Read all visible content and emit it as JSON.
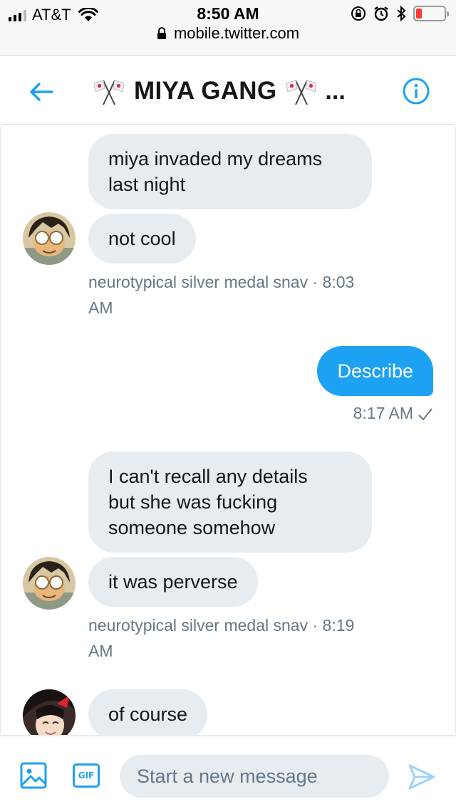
{
  "status_bar": {
    "carrier": "AT&T",
    "time": "8:50 AM",
    "url": "mobile.twitter.com"
  },
  "header": {
    "title": "MIYA GANG",
    "ellipsis": "...",
    "flag_icon": "crossed-flags-icon"
  },
  "messages": [
    {
      "type": "received",
      "text": "miya invaded my dreams\nlast night"
    },
    {
      "type": "received",
      "text": "not cool"
    },
    {
      "type": "meta",
      "text": "neurotypical silver medal snav · 8:03\nAM"
    },
    {
      "type": "sent",
      "text": "Describe"
    },
    {
      "type": "meta_sent",
      "text": "8:17 AM"
    },
    {
      "type": "received",
      "text": "I can't recall any details\nbut she was fucking\nsomeone somehow"
    },
    {
      "type": "received",
      "text": "it was perverse"
    },
    {
      "type": "meta",
      "text": "neurotypical silver medal snav · 8:19\nAM"
    },
    {
      "type": "received",
      "text": "of course"
    }
  ],
  "composer": {
    "placeholder": "Start a new message",
    "gif_label": "GIF"
  },
  "colors": {
    "accent": "#1da1f2",
    "bubble_received": "#e6ecf0",
    "meta_text": "#657786",
    "battery_low": "#ff3b30"
  }
}
